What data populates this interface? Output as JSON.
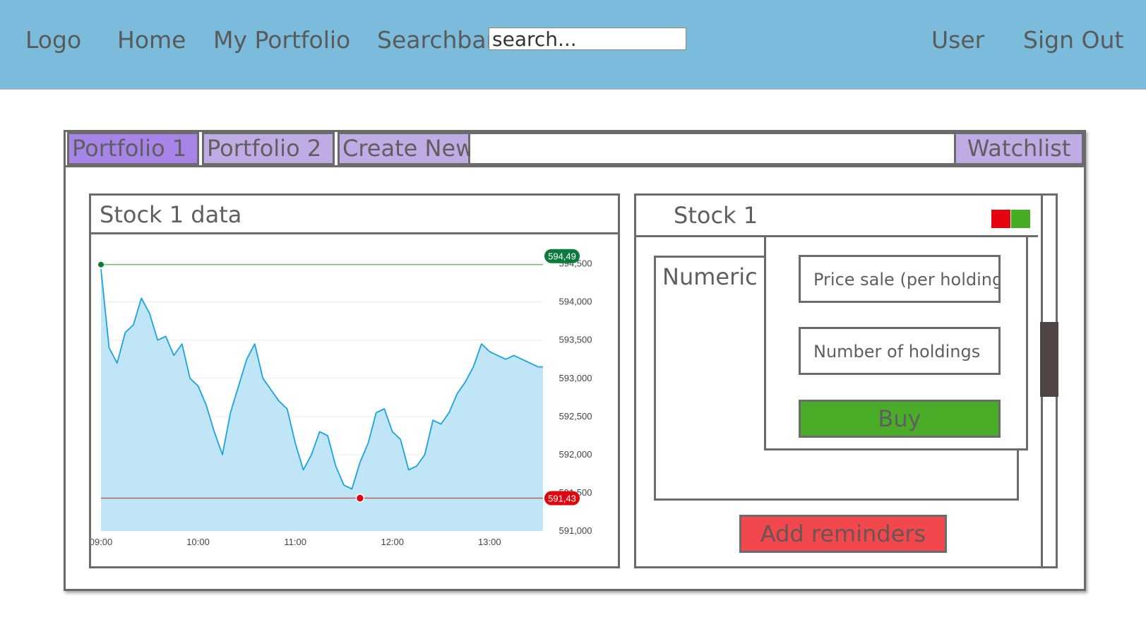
{
  "nav": {
    "logo": "Logo",
    "home": "Home",
    "portfolio": "My Portfolio",
    "search_label": "Searchbar",
    "search_placeholder": "search...",
    "user": "User",
    "sign_out": "Sign Out"
  },
  "tabs": {
    "portfolio_1": "Portfolio 1",
    "portfolio_2": "Portfolio 2",
    "create_new": "Create New",
    "watchlist": "Watchlist"
  },
  "chart_card": {
    "title": "Stock 1 data"
  },
  "stock_card": {
    "title": "Stock 1",
    "numeric_label": "Numeric D",
    "price_field": "Price sale (per holding)",
    "holdings_field": "Number of holdings",
    "buy_label": "Buy",
    "reminders_label": "Add reminders",
    "colors": {
      "down": "#e8040e",
      "up": "#46ad23"
    }
  },
  "chart_data": {
    "type": "area",
    "title": "",
    "xlabel": "",
    "ylabel": "",
    "x_ticks": [
      "09:00",
      "10:00",
      "11:00",
      "12:00",
      "13:00"
    ],
    "y_ticks": [
      "591,000",
      "591,500",
      "592,000",
      "592,500",
      "593,000",
      "593,500",
      "594,000",
      "594,500"
    ],
    "ylim": [
      591000,
      594700
    ],
    "xlim": [
      "09:00",
      "13:33"
    ],
    "high": {
      "label": "594,49",
      "value": 594490,
      "time": "09:00"
    },
    "low": {
      "label": "591,43",
      "value": 591430,
      "time": "11:40"
    },
    "line_color": "#1aa3df",
    "fill_color": "#bfe5f6",
    "series": [
      {
        "x": [
          "09:00",
          "09:05",
          "09:10",
          "09:15",
          "09:20",
          "09:25",
          "09:30",
          "09:35",
          "09:40",
          "09:45",
          "09:50",
          "09:55",
          "10:00",
          "10:05",
          "10:10",
          "10:15",
          "10:20",
          "10:25",
          "10:30",
          "10:35",
          "10:40",
          "10:45",
          "10:50",
          "10:55",
          "11:00",
          "11:05",
          "11:10",
          "11:15",
          "11:20",
          "11:25",
          "11:30",
          "11:35",
          "11:40",
          "11:45",
          "11:50",
          "11:55",
          "12:00",
          "12:05",
          "12:10",
          "12:15",
          "12:20",
          "12:25",
          "12:30",
          "12:35",
          "12:40",
          "12:45",
          "12:50",
          "12:55",
          "13:00",
          "13:05",
          "13:10",
          "13:15",
          "13:20",
          "13:25",
          "13:30",
          "13:33"
        ],
        "values": [
          594430,
          593400,
          593200,
          593600,
          593700,
          594050,
          593850,
          593500,
          593550,
          593300,
          593450,
          593000,
          592900,
          592650,
          592300,
          592000,
          592550,
          592900,
          593250,
          593450,
          593000,
          592850,
          592700,
          592600,
          592150,
          591800,
          592000,
          592300,
          592250,
          591850,
          591600,
          591550,
          591900,
          592150,
          592550,
          592600,
          592300,
          592200,
          591800,
          591850,
          592000,
          592450,
          592400,
          592550,
          592800,
          592950,
          593150,
          593450,
          593350,
          593300,
          593250,
          593300,
          593250,
          593200,
          593150,
          593150
        ]
      }
    ]
  }
}
